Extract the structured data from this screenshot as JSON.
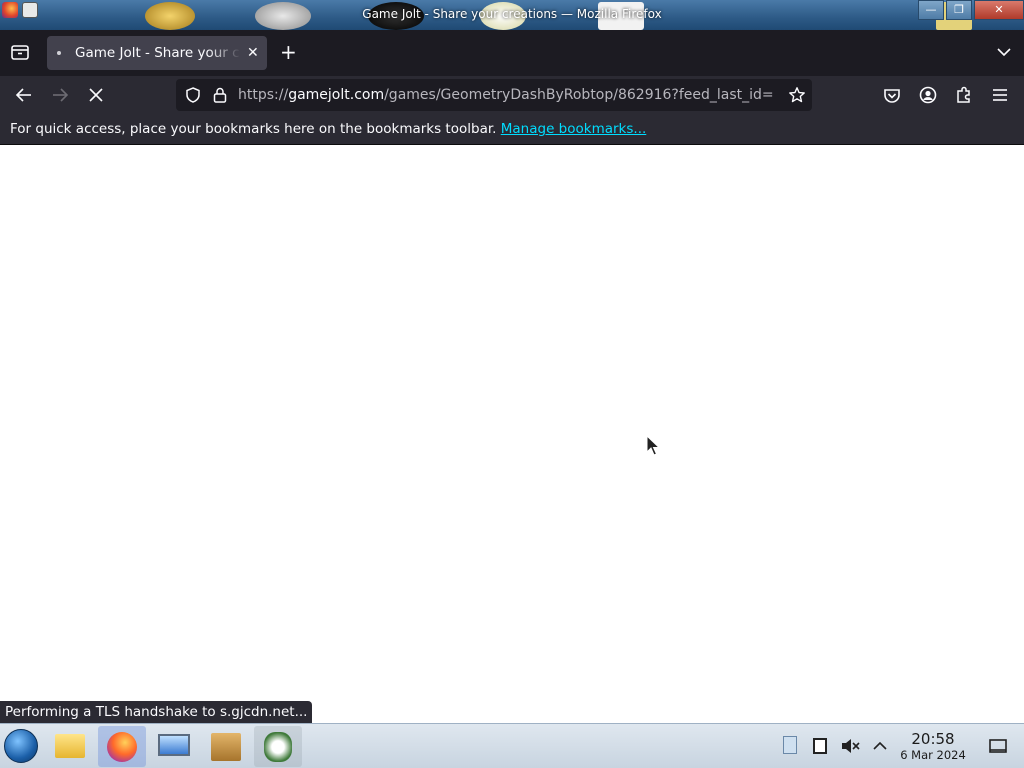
{
  "window": {
    "title": "Game Jolt - Share your creations — Mozilla Firefox"
  },
  "tabs": [
    {
      "label": "Game Jolt - Share your creations",
      "close_glyph": "✕"
    }
  ],
  "new_tab_glyph": "+",
  "navbar": {
    "url_scheme": "https://",
    "url_host": "gamejolt.com",
    "url_path": "/games/GeometryDashByRobtop/862916?feed_last_id=",
    "loading": true
  },
  "bookmarks_toolbar": {
    "message": "For quick access, place your bookmarks here on the bookmarks toolbar.",
    "link": "Manage bookmarks..."
  },
  "status_text": "Performing a TLS handshake to s.gjcdn.net...",
  "taskbar": {
    "apps": [
      "file-manager",
      "firefox",
      "system-settings",
      "package-installer",
      "image-viewer"
    ],
    "active_app": "firefox",
    "clock": {
      "time": "20:58",
      "date": "6 Mar 2024"
    }
  },
  "colors": {
    "accent_link": "#00ddff",
    "toolbar_bg": "#2b2a33",
    "tabstrip_bg": "#1c1b22"
  }
}
